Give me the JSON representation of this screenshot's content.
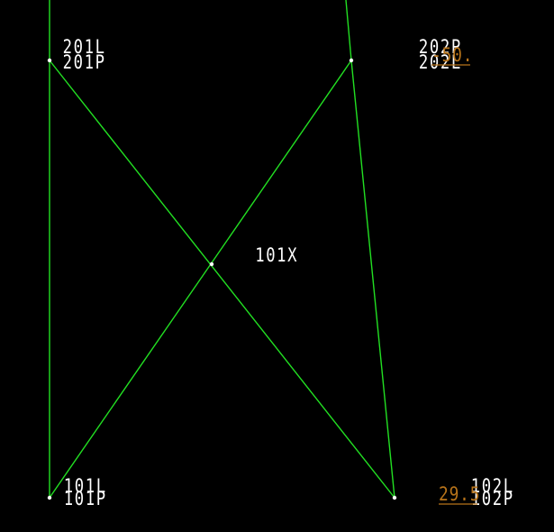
{
  "colors": {
    "background": "#000000",
    "edge": "#22e022",
    "label": "#ffffff",
    "annotation": "#b8741a"
  },
  "node_labels": {
    "n201_a": "201L",
    "n201_b": "201P",
    "n202_a": "202P",
    "n202_b": "202L",
    "n101x": "101X",
    "n101_a": "101L",
    "n101_b": "101P",
    "n102_a": "102L",
    "n102_b": "102P"
  },
  "annotations": {
    "top_right": "-50.",
    "bottom_right": "29.5"
  }
}
